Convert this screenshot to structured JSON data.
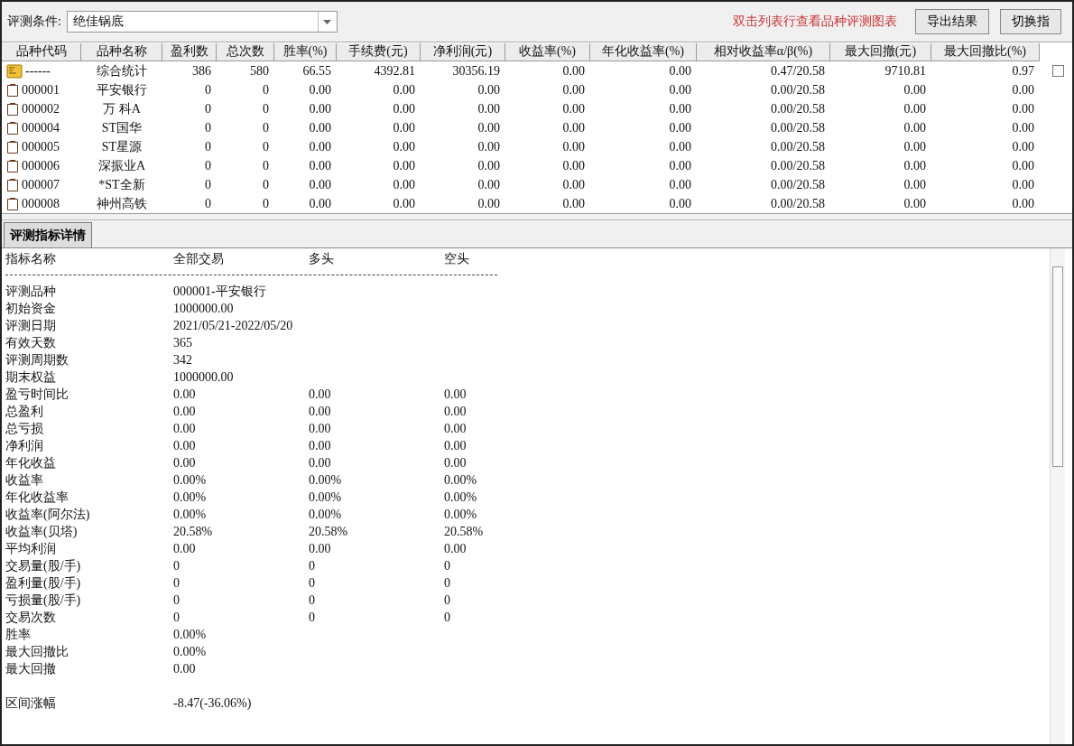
{
  "toolbar": {
    "condition_label": "评测条件:",
    "condition_value": "绝佳锅底",
    "hint": "双击列表行查看品种评测图表",
    "buttons": [
      "导出结果",
      "切换指"
    ]
  },
  "table": {
    "columns": [
      "品种代码",
      "品种名称",
      "盈利数",
      "总次数",
      "胜率(%)",
      "手续费(元)",
      "净利润(元)",
      "收益率(%)",
      "年化收益率(%)",
      "相对收益率α/β(%)",
      "最大回撤(元)",
      "最大回撤比(%)"
    ],
    "rows": [
      {
        "kind": "summary",
        "cells": [
          "------",
          "综合统计",
          "386",
          "580",
          "66.55",
          "4392.81",
          "30356.19",
          "0.00",
          "0.00",
          "0.47/20.58",
          "9710.81",
          "0.97"
        ]
      },
      {
        "kind": "stock",
        "cells": [
          "000001",
          "平安银行",
          "0",
          "0",
          "0.00",
          "0.00",
          "0.00",
          "0.00",
          "0.00",
          "0.00/20.58",
          "0.00",
          "0.00"
        ]
      },
      {
        "kind": "stock",
        "cells": [
          "000002",
          "万 科A",
          "0",
          "0",
          "0.00",
          "0.00",
          "0.00",
          "0.00",
          "0.00",
          "0.00/20.58",
          "0.00",
          "0.00"
        ]
      },
      {
        "kind": "stock",
        "cells": [
          "000004",
          "ST国华",
          "0",
          "0",
          "0.00",
          "0.00",
          "0.00",
          "0.00",
          "0.00",
          "0.00/20.58",
          "0.00",
          "0.00"
        ]
      },
      {
        "kind": "stock",
        "cells": [
          "000005",
          "ST星源",
          "0",
          "0",
          "0.00",
          "0.00",
          "0.00",
          "0.00",
          "0.00",
          "0.00/20.58",
          "0.00",
          "0.00"
        ]
      },
      {
        "kind": "stock",
        "cells": [
          "000006",
          "深振业A",
          "0",
          "0",
          "0.00",
          "0.00",
          "0.00",
          "0.00",
          "0.00",
          "0.00/20.58",
          "0.00",
          "0.00"
        ]
      },
      {
        "kind": "stock",
        "cells": [
          "000007",
          "*ST全新",
          "0",
          "0",
          "0.00",
          "0.00",
          "0.00",
          "0.00",
          "0.00",
          "0.00/20.58",
          "0.00",
          "0.00"
        ]
      },
      {
        "kind": "stock",
        "cells": [
          "000008",
          "神州高铁",
          "0",
          "0",
          "0.00",
          "0.00",
          "0.00",
          "0.00",
          "0.00",
          "0.00/20.58",
          "0.00",
          "0.00"
        ]
      }
    ],
    "checkbox": {
      "checked": false
    }
  },
  "tabs": [
    {
      "label": "评测指标详情",
      "selected": true
    }
  ],
  "details": {
    "headers": [
      "指标名称",
      "全部交易",
      "多头",
      "空头"
    ],
    "sections": [
      [
        [
          "评测品种",
          "000001-平安银行"
        ],
        [
          "初始资金",
          "1000000.00"
        ],
        [
          "评测日期",
          "2021/05/21-2022/05/20"
        ],
        [
          "有效天数",
          "365"
        ],
        [
          "评测周期数",
          "342"
        ],
        [
          "期末权益",
          "1000000.00"
        ],
        [
          "盈亏时间比",
          "0.00",
          "0.00",
          "0.00"
        ],
        [
          "总盈利",
          "0.00",
          "0.00",
          "0.00"
        ],
        [
          "总亏损",
          "0.00",
          "0.00",
          "0.00"
        ],
        [
          "净利润",
          "0.00",
          "0.00",
          "0.00"
        ],
        [
          "年化收益",
          "0.00",
          "0.00",
          "0.00"
        ],
        [
          "收益率",
          "0.00%",
          "0.00%",
          "0.00%"
        ],
        [
          "年化收益率",
          "0.00%",
          "0.00%",
          "0.00%"
        ],
        [
          "收益率(阿尔法)",
          "0.00%",
          "0.00%",
          "0.00%"
        ],
        [
          "收益率(贝塔)",
          "20.58%",
          "20.58%",
          "20.58%"
        ],
        [
          "平均利润",
          "0.00",
          "0.00",
          "0.00"
        ],
        [
          "交易量(股/手)",
          "0",
          "0",
          "0"
        ],
        [
          "盈利量(股/手)",
          "0",
          "0",
          "0"
        ],
        [
          "亏损量(股/手)",
          "0",
          "0",
          "0"
        ],
        [
          "交易次数",
          "0",
          "0",
          "0"
        ],
        [
          "胜率",
          "0.00%"
        ],
        [
          "最大回撤比",
          "0.00%"
        ],
        [
          "最大回撤",
          "0.00"
        ]
      ],
      [
        [
          "区间涨幅",
          "-8.47(-36.06%)"
        ]
      ]
    ]
  }
}
